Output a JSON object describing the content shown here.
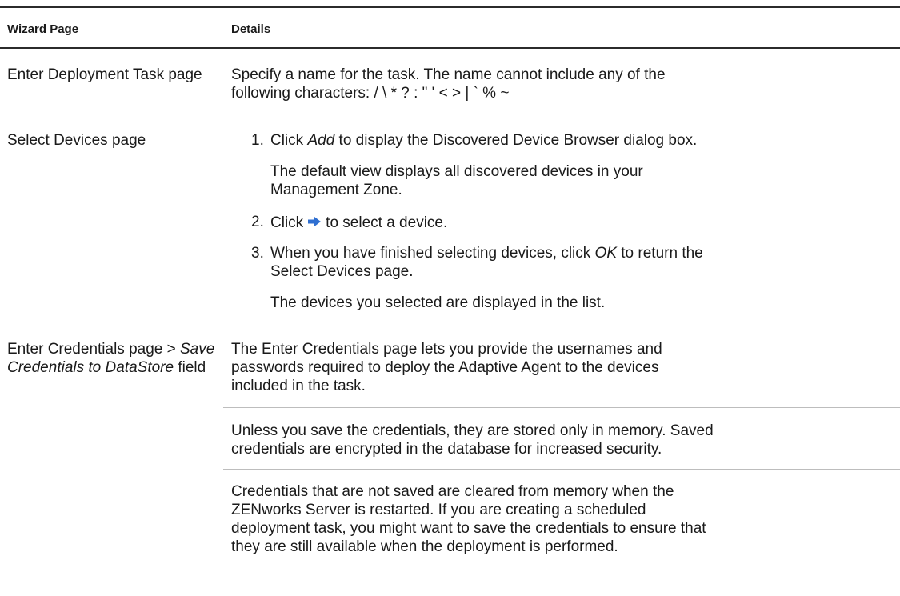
{
  "table": {
    "headers": {
      "wizard_page": "Wizard Page",
      "details": "Details"
    },
    "rows": [
      {
        "page": "Enter Deployment Task page",
        "details": {
          "line1": "Specify a name for the task. The name cannot include any of the",
          "line2": "following characters: / \\ * ? : \" ' < > | ` % ~"
        }
      },
      {
        "page": "Select Devices page",
        "steps": [
          {
            "num": "1.",
            "pre": "Click ",
            "em": "Add",
            "post": " to display the Discovered Device Browser dialog box.",
            "sub": [
              "The default view displays all discovered devices in your",
              "Management Zone."
            ]
          },
          {
            "num": "2.",
            "pre": "Click",
            "icon": "right-arrow-icon",
            "post": "to select a device."
          },
          {
            "num": "3.",
            "pre": "When you have finished selecting devices, click ",
            "em": "OK",
            "post": " to return the",
            "line2": "Select Devices page.",
            "sub": [
              "The devices you selected are displayed in the list."
            ]
          }
        ]
      },
      {
        "page_line1": "Enter Credentials page > ",
        "page_em1": "Save",
        "page_em2": "Credentials to DataStore",
        "page_post": " field",
        "paragraphs": [
          [
            "The Enter Credentials page lets you provide the usernames and",
            "passwords required to deploy the Adaptive Agent to the devices",
            "included in the task."
          ],
          [
            "Unless you save the credentials, they are stored only in memory. Saved",
            "credentials are encrypted in the database for increased security."
          ],
          [
            "Credentials that are not saved are cleared from memory when the",
            "ZENworks Server is restarted. If you are creating a scheduled",
            "deployment task, you might want to save the credentials to ensure that",
            "they are still available when the deployment is performed."
          ]
        ]
      }
    ]
  }
}
